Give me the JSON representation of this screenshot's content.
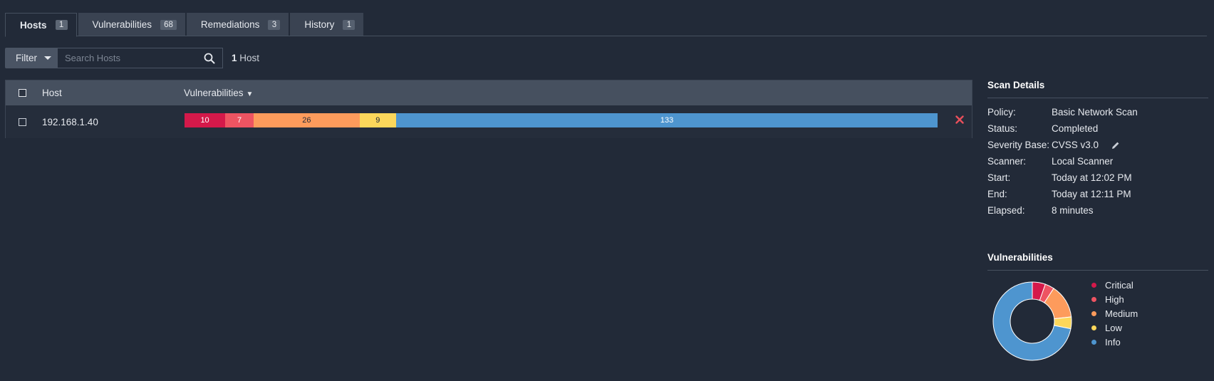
{
  "tabs": [
    {
      "label": "Hosts",
      "count": "1"
    },
    {
      "label": "Vulnerabilities",
      "count": "68"
    },
    {
      "label": "Remediations",
      "count": "3"
    },
    {
      "label": "History",
      "count": "1"
    }
  ],
  "filter": {
    "button_label": "Filter",
    "search_placeholder": "Search Hosts",
    "count_number": "1",
    "count_label": "Host"
  },
  "table": {
    "headers": {
      "host": "Host",
      "vulnerabilities": "Vulnerabilities",
      "sort_indicator": "▼"
    },
    "rows": [
      {
        "host": "192.168.1.40",
        "severity_counts": {
          "critical": "10",
          "high": "7",
          "medium": "26",
          "low": "9",
          "info": "133"
        }
      }
    ]
  },
  "scan_details": {
    "title": "Scan Details",
    "items": [
      {
        "label": "Policy:",
        "value": "Basic Network Scan"
      },
      {
        "label": "Status:",
        "value": "Completed"
      },
      {
        "label": "Severity Base:",
        "value": "CVSS v3.0"
      },
      {
        "label": "Scanner:",
        "value": "Local Scanner"
      },
      {
        "label": "Start:",
        "value": "Today at 12:02 PM"
      },
      {
        "label": "End:",
        "value": "Today at 12:11 PM"
      },
      {
        "label": "Elapsed:",
        "value": "8 minutes"
      }
    ]
  },
  "vulnerabilities_chart": {
    "title": "Vulnerabilities",
    "legend": [
      "Critical",
      "High",
      "Medium",
      "Low",
      "Info"
    ]
  },
  "chart_data": {
    "type": "pie",
    "categories": [
      "Critical",
      "High",
      "Medium",
      "Low",
      "Info"
    ],
    "values": [
      10,
      7,
      26,
      9,
      133
    ],
    "colors": [
      "#d4194a",
      "#ee5462",
      "#fd9b5c",
      "#fcd75b",
      "#4e95cf"
    ],
    "title": "Vulnerabilities"
  },
  "colors": {
    "critical": "#d4194a",
    "high": "#ee5462",
    "medium": "#fd9b5c",
    "low": "#fcd75b",
    "info": "#4e95cf",
    "remove": "#e8505b"
  },
  "icons": {
    "search": "search-icon",
    "filter_caret": "caret-down-icon",
    "remove": "close-icon",
    "edit": "pencil-icon"
  }
}
